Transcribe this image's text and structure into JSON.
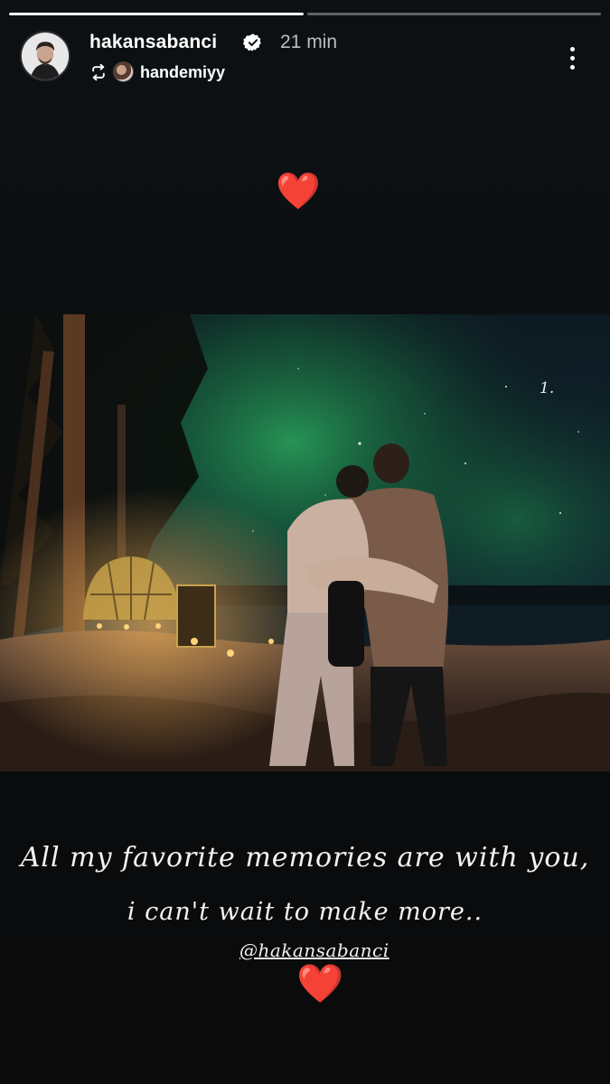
{
  "progress": {
    "segments": 2,
    "current_fill": 1.0,
    "active_index": 0
  },
  "header": {
    "username": "hakansabanci",
    "verified": true,
    "time": "21 min",
    "reposted_by": "handemiyy"
  },
  "icons": {
    "avatar": "profile-photo-avatar",
    "verified": "verified-badge-icon",
    "repost": "repost-icon",
    "more": "more-options-icon"
  },
  "story": {
    "heart_top": "❤️",
    "photo_number": "1.",
    "caption_line1": "All my favorite memories are with you,",
    "caption_line2": "i can't wait to make more..",
    "mention": "@hakansabanci",
    "heart_bottom": "❤️"
  },
  "colors": {
    "background": "#0b0e10",
    "heart": "#e0202c",
    "aurora": "#1f8a4c"
  }
}
